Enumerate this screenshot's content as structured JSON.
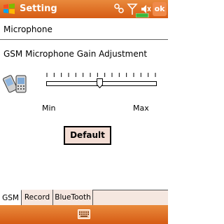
{
  "titlebar": {
    "title": "Setting",
    "ok_label": "ok"
  },
  "header": {
    "title": "Microphone"
  },
  "section": {
    "label": "GSM Microphone Gain Adjustment"
  },
  "slider": {
    "min_label": "Min",
    "max_label": "Max",
    "value_fraction": 0.5,
    "tick_count": 16
  },
  "default_button": {
    "label": "Default"
  },
  "tabs": [
    {
      "label": "GSM",
      "active": true
    },
    {
      "label": "Record",
      "active": false
    },
    {
      "label": "BlueTooth",
      "active": false
    }
  ],
  "colors": {
    "bar": "#d65b14",
    "button_fill": "#f3ddd4",
    "tab_bg": "#f5e7e0"
  }
}
